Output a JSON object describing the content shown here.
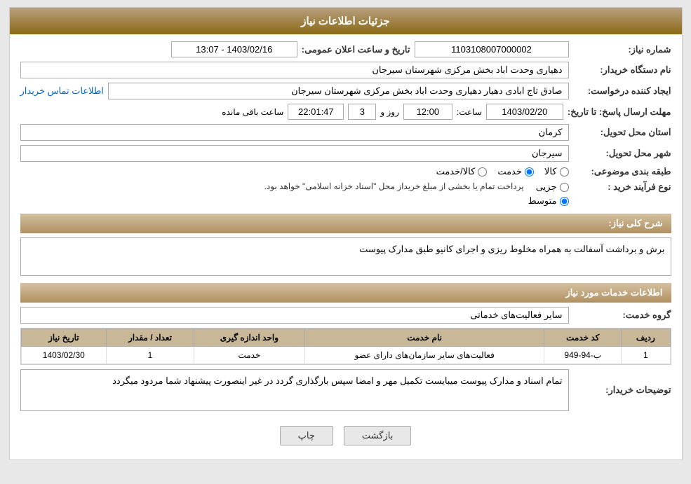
{
  "header": {
    "title": "جزئیات اطلاعات نیاز"
  },
  "fields": {
    "need_number_label": "شماره نیاز:",
    "need_number_value": "1103108007000002",
    "buyer_station_label": "نام دستگاه خریدار:",
    "buyer_station_value": "دهیاری وحدت اباد بخش مرکزی شهرستان سیرجان",
    "creator_label": "ایجاد کننده درخواست:",
    "creator_value": "صادق تاج ابادی  دهیار دهیاری وحدت اباد بخش مرکزی شهرستان سیرجان",
    "contact_link": "اطلاعات تماس خریدار",
    "deadline_label": "مهلت ارسال پاسخ: تا تاریخ:",
    "deadline_date": "1403/02/20",
    "deadline_time_label": "ساعت:",
    "deadline_time": "12:00",
    "deadline_day_label": "روز و",
    "deadline_days": "3",
    "deadline_remaining_label": "ساعت باقی مانده",
    "deadline_remaining": "22:01:47",
    "announce_label": "تاریخ و ساعت اعلان عمومی:",
    "announce_value": "1403/02/16 - 13:07",
    "province_label": "استان محل تحویل:",
    "province_value": "کرمان",
    "city_label": "شهر محل تحویل:",
    "city_value": "سیرجان",
    "category_label": "طبقه بندی موضوعی:",
    "category_options": [
      "کالا",
      "خدمت",
      "کالا/خدمت"
    ],
    "category_selected": "خدمت",
    "purchase_type_label": "نوع فرآیند خرید :",
    "purchase_type_options": [
      "جزیی",
      "متوسط"
    ],
    "purchase_type_selected": "متوسط",
    "purchase_type_desc": "پرداخت تمام یا بخشی از مبلغ خریداز محل \"اسناد خزانه اسلامی\" خواهد بود.",
    "need_desc_label": "شرح کلی نیاز:",
    "need_desc_value": "برش و برداشت آسفالت به همراه مخلوط ریزی و اجرای کانیو طبق مدارک پیوست",
    "services_label": "اطلاعات خدمات مورد نیاز",
    "service_group_label": "گروه خدمت:",
    "service_group_value": "سایر فعالیت‌های خدماتی",
    "table": {
      "headers": [
        "ردیف",
        "کد خدمت",
        "نام خدمت",
        "واحد اندازه گیری",
        "تعداد / مقدار",
        "تاریخ نیاز"
      ],
      "rows": [
        {
          "row_num": "1",
          "code": "ب-94-949",
          "name": "فعالیت‌های سایر سازمان‌های دارای عضو",
          "unit": "خدمت",
          "quantity": "1",
          "date": "1403/02/30"
        }
      ]
    },
    "buyer_desc_label": "توضیحات خریدار:",
    "buyer_desc_value": "تمام اسناد و مدارک پیوست میبایست تکمیل مهر و امضا سپس بارگذاری گردد در غیر اینصورت پیشنهاد شما مردود میگردد"
  },
  "buttons": {
    "print": "چاپ",
    "back": "بازگشت"
  }
}
